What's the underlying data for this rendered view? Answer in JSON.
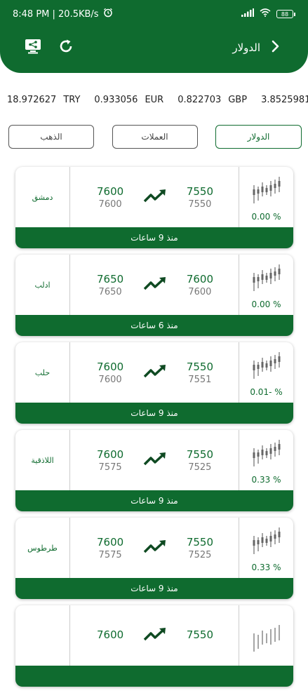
{
  "status_bar": {
    "time_speed": "8:48 PM | 20.5KB/s",
    "battery": "88"
  },
  "header": {
    "title": "الدولار"
  },
  "ticker": [
    {
      "value": "18.972627",
      "code": "TRY"
    },
    {
      "value": "0.933056",
      "code": "EUR"
    },
    {
      "value": "0.822703",
      "code": "GBP"
    },
    {
      "value": "3.8525981",
      "code": ""
    }
  ],
  "tabs": [
    {
      "label": "الذهب",
      "active": false
    },
    {
      "label": "العملات",
      "active": false
    },
    {
      "label": "الدولار",
      "active": true
    }
  ],
  "cards": [
    {
      "city": "دمشق",
      "left_main": "7600",
      "left_sub": "7600",
      "right_main": "7550",
      "right_sub": "7550",
      "change": "0.00 %",
      "footer": "منذ 9 ساعات"
    },
    {
      "city": "ادلب",
      "left_main": "7650",
      "left_sub": "7650",
      "right_main": "7600",
      "right_sub": "7600",
      "change": "0.00 %",
      "footer": "منذ 6 ساعات"
    },
    {
      "city": "حلب",
      "left_main": "7600",
      "left_sub": "7600",
      "right_main": "7550",
      "right_sub": "7551",
      "change": "0.01- %",
      "footer": "منذ 9 ساعات"
    },
    {
      "city": "اللاذقية",
      "left_main": "7600",
      "left_sub": "7575",
      "right_main": "7550",
      "right_sub": "7525",
      "change": "0.33 %",
      "footer": "منذ 9 ساعات"
    },
    {
      "city": "طرطوس",
      "left_main": "7600",
      "left_sub": "7575",
      "right_main": "7550",
      "right_sub": "7525",
      "change": "0.33 %",
      "footer": "منذ 9 ساعات"
    },
    {
      "city": "",
      "left_main": "7600",
      "left_sub": "",
      "right_main": "7550",
      "right_sub": "",
      "change": "",
      "footer": ""
    }
  ],
  "colors": {
    "brand_green": "#0f6b2f"
  },
  "icons": [
    "alarm-icon",
    "signal-icon",
    "wifi-icon",
    "battery-icon",
    "share-screen-icon",
    "refresh-icon",
    "chevron-right-icon",
    "trending-up-icon",
    "sparkline-icon"
  ]
}
